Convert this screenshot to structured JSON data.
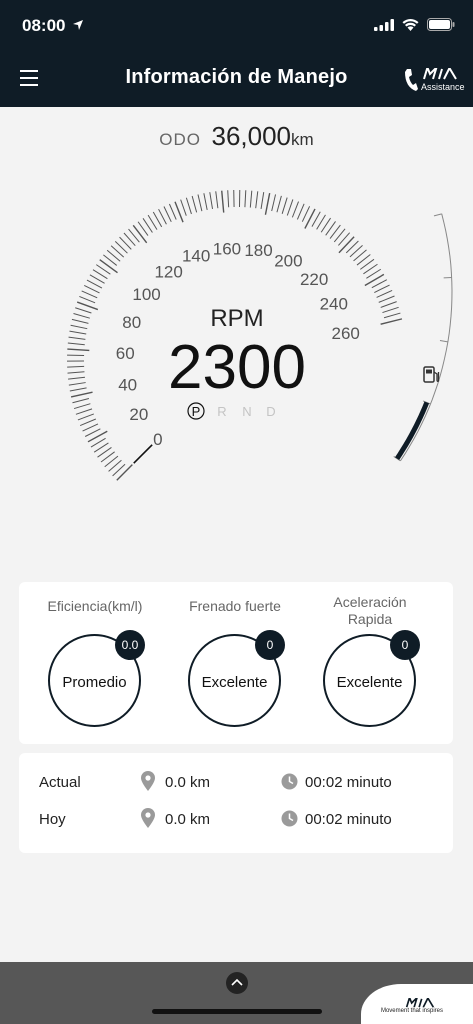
{
  "status_bar": {
    "time": "08:00",
    "location_icon": "location-arrow-icon",
    "signal_icon": "cellular-signal-icon",
    "wifi_icon": "wifi-icon",
    "battery_icon": "battery-icon",
    "battery_level": 1.0
  },
  "header": {
    "title": "Información de Manejo",
    "menu_icon": "hamburger-menu-icon",
    "assistance": {
      "brand": "KIA",
      "label": "Assistance"
    }
  },
  "odometer": {
    "label": "ODO",
    "value": "36,000",
    "unit": "km"
  },
  "gauge": {
    "rpm_label": "RPM",
    "rpm_value": "2300",
    "ticks": [
      "0",
      "20",
      "40",
      "60",
      "80",
      "100",
      "120",
      "140",
      "160",
      "180",
      "200",
      "220",
      "240",
      "260"
    ],
    "gears": [
      "P",
      "R",
      "N",
      "D"
    ],
    "selected_gear": "P",
    "fuel_icon": "fuel-pump-icon",
    "fuel_level": 0.25,
    "speed_min": 0,
    "speed_max": 260
  },
  "scores": [
    {
      "caption": "Eficiencia(km/l)",
      "badge": "0.0",
      "rating": "Promedio"
    },
    {
      "caption": "Frenado fuerte",
      "badge": "0",
      "rating": "Excelente"
    },
    {
      "caption": "Aceleración Rapida",
      "badge": "0",
      "rating": "Excelente"
    }
  ],
  "trips": [
    {
      "name": "Actual",
      "distance": "0.0 km",
      "duration": "00:02 minuto"
    },
    {
      "name": "Hoy",
      "distance": "0.0 km",
      "duration": "00:02 minuto"
    }
  ],
  "footer": {
    "expand_icon": "chevron-up-icon",
    "brand": "KIA",
    "slogan": "Movement that inspires"
  }
}
